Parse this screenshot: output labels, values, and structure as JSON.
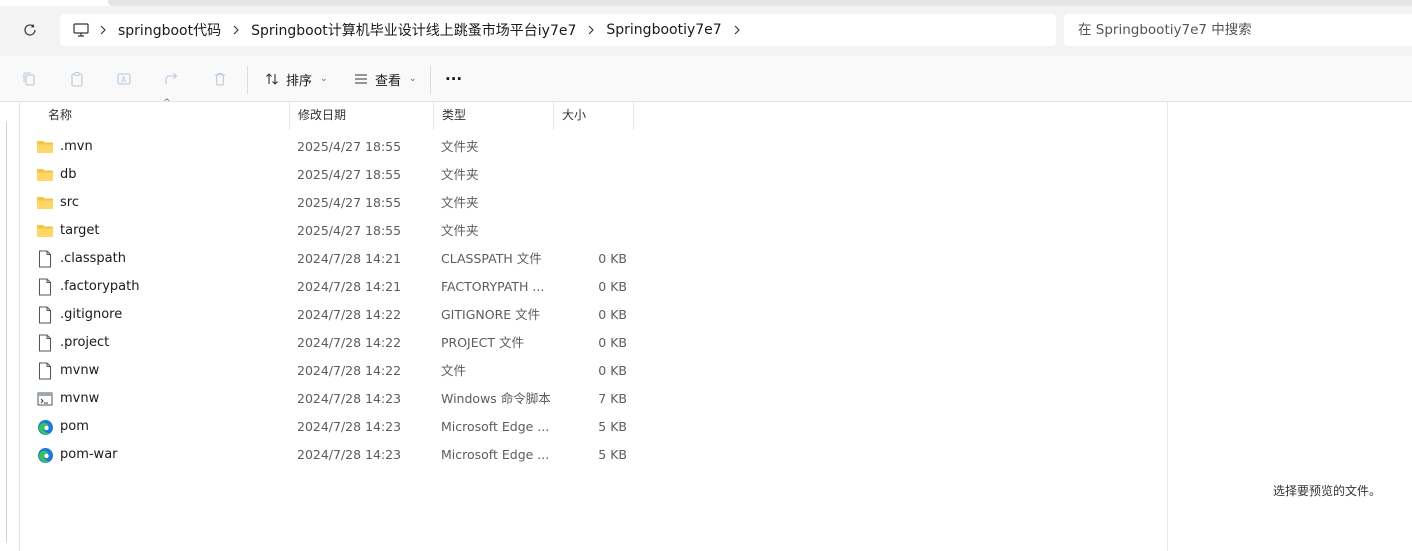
{
  "breadcrumb": {
    "items": [
      "springboot代码",
      "Springboot计算机毕业设计线上跳蚤市场平台iy7e7",
      "Springbootiy7e7"
    ]
  },
  "search": {
    "placeholder": "在 Springbootiy7e7 中搜索"
  },
  "toolbar": {
    "icons": [
      "copy-icon",
      "paste-icon",
      "rename-icon",
      "share-icon",
      "delete-icon"
    ],
    "sort_label": "排序",
    "view_label": "查看",
    "more_label": "···"
  },
  "columns": {
    "name": "名称",
    "date": "修改日期",
    "type": "类型",
    "size": "大小"
  },
  "files": [
    {
      "name": ".mvn",
      "date": "2025/4/27 18:55",
      "type": "文件夹",
      "size": "",
      "icon": "folder-icon"
    },
    {
      "name": "db",
      "date": "2025/4/27 18:55",
      "type": "文件夹",
      "size": "",
      "icon": "folder-icon"
    },
    {
      "name": "src",
      "date": "2025/4/27 18:55",
      "type": "文件夹",
      "size": "",
      "icon": "folder-icon"
    },
    {
      "name": "target",
      "date": "2025/4/27 18:55",
      "type": "文件夹",
      "size": "",
      "icon": "folder-icon"
    },
    {
      "name": ".classpath",
      "date": "2024/7/28 14:21",
      "type": "CLASSPATH 文件",
      "size": "0 KB",
      "icon": "file-icon"
    },
    {
      "name": ".factorypath",
      "date": "2024/7/28 14:21",
      "type": "FACTORYPATH ...",
      "size": "0 KB",
      "icon": "file-icon"
    },
    {
      "name": ".gitignore",
      "date": "2024/7/28 14:22",
      "type": "GITIGNORE 文件",
      "size": "0 KB",
      "icon": "file-icon"
    },
    {
      "name": ".project",
      "date": "2024/7/28 14:22",
      "type": "PROJECT 文件",
      "size": "0 KB",
      "icon": "file-icon"
    },
    {
      "name": "mvnw",
      "date": "2024/7/28 14:22",
      "type": "文件",
      "size": "0 KB",
      "icon": "file-icon"
    },
    {
      "name": "mvnw",
      "date": "2024/7/28 14:23",
      "type": "Windows 命令脚本",
      "size": "7 KB",
      "icon": "cmd-script-icon"
    },
    {
      "name": "pom",
      "date": "2024/7/28 14:23",
      "type": "Microsoft Edge ...",
      "size": "5 KB",
      "icon": "edge-icon"
    },
    {
      "name": "pom-war",
      "date": "2024/7/28 14:23",
      "type": "Microsoft Edge ...",
      "size": "5 KB",
      "icon": "edge-icon"
    }
  ],
  "preview": {
    "empty_text": "选择要预览的文件。"
  },
  "colors": {
    "folder": "#f5c242",
    "edge_blue": "#1d7ad8",
    "edge_green": "#3cc25b",
    "accent": "#005fb8"
  }
}
